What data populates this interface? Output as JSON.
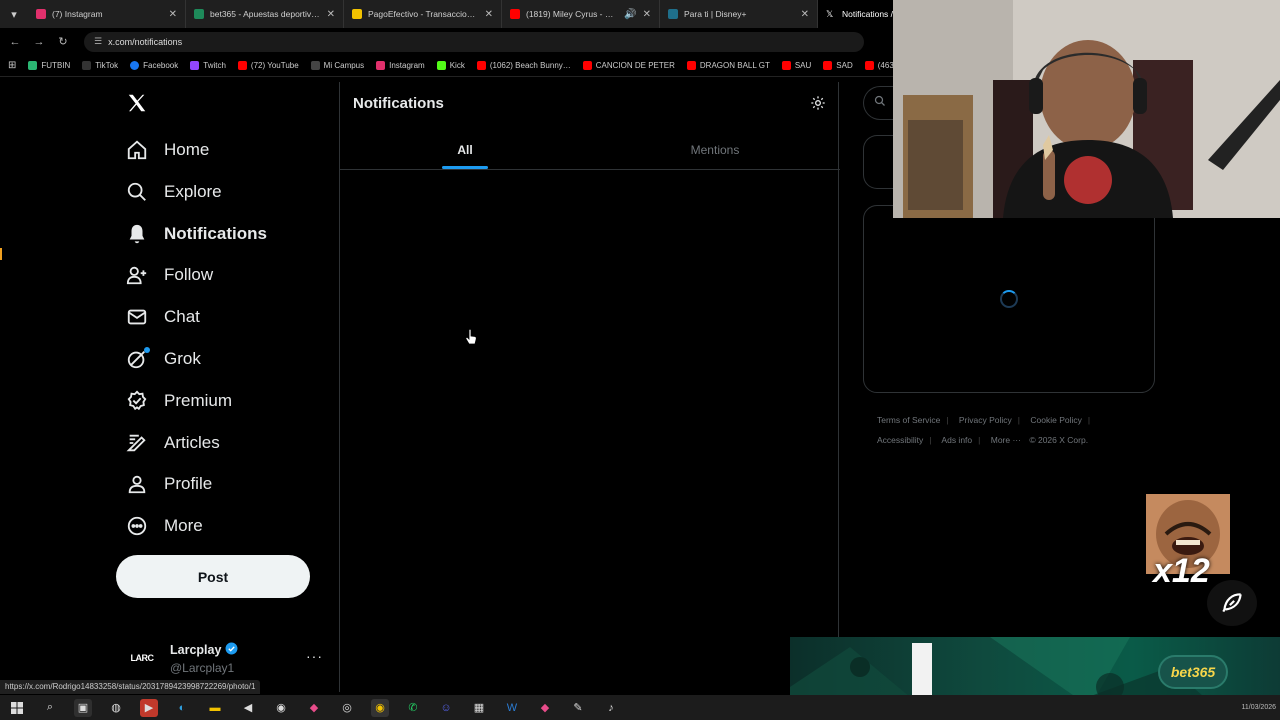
{
  "browser": {
    "tabs": [
      {
        "title": "(7) Instagram",
        "color": "#e1306c"
      },
      {
        "title": "bet365 - Apuestas deportivas en…",
        "color": "#1e8a5a"
      },
      {
        "title": "PagoEfectivo - Transacciones Se…",
        "color": "#f2c200"
      },
      {
        "title": "(1819) Miley Cyrus - Party In…",
        "color": "#ff0000"
      },
      {
        "title": "Para ti | Disney+",
        "color": "#1f6f8b"
      },
      {
        "title": "Notifications /",
        "color": "#ffffff"
      }
    ],
    "url": "x.com/notifications",
    "bookmarks": [
      {
        "label": "FUTBIN",
        "color": "#2bb673"
      },
      {
        "label": "TikTok",
        "color": "#ffffff"
      },
      {
        "label": "Facebook",
        "color": "#1877f2"
      },
      {
        "label": "Twitch",
        "color": "#9146ff"
      },
      {
        "label": "(72) YouTube",
        "color": "#ff0000"
      },
      {
        "label": "Mi Campus",
        "color": "#444444"
      },
      {
        "label": "Instagram",
        "color": "#e1306c"
      },
      {
        "label": "Kick",
        "color": "#53fc18"
      },
      {
        "label": "(1062) Beach Bunny…",
        "color": "#ff0000"
      },
      {
        "label": "CANCION DE PETER",
        "color": "#ff0000"
      },
      {
        "label": "DRAGON BALL GT",
        "color": "#ff0000"
      },
      {
        "label": "SAU",
        "color": "#ff0000"
      },
      {
        "label": "SAD",
        "color": "#ff0000"
      },
      {
        "label": "(463) J",
        "color": "#ff0000"
      }
    ],
    "status_url": "https://x.com/Rodrigo14833258/status/2031789423998722269/photo/1"
  },
  "nav": {
    "items": [
      {
        "label": "Home",
        "icon": "home-icon"
      },
      {
        "label": "Explore",
        "icon": "search-icon"
      },
      {
        "label": "Notifications",
        "icon": "bell-icon"
      },
      {
        "label": "Follow",
        "icon": "follow-icon"
      },
      {
        "label": "Chat",
        "icon": "mail-icon"
      },
      {
        "label": "Grok",
        "icon": "grok-icon"
      },
      {
        "label": "Premium",
        "icon": "premium-icon"
      },
      {
        "label": "Articles",
        "icon": "articles-icon"
      },
      {
        "label": "Profile",
        "icon": "profile-icon"
      },
      {
        "label": "More",
        "icon": "more-icon"
      }
    ],
    "post_label": "Post"
  },
  "account": {
    "avatar_text": "LARC",
    "name": "Larcplay",
    "handle": "@Larcplay1"
  },
  "main": {
    "title": "Notifications",
    "tabs": [
      {
        "label": "All",
        "active": true
      },
      {
        "label": "Mentions",
        "active": false
      }
    ]
  },
  "footer": {
    "links": [
      "Terms of Service",
      "Privacy Policy",
      "Cookie Policy",
      "Accessibility",
      "Ads info",
      "More ···"
    ],
    "copyright": "© 2026 X Corp."
  },
  "overlay": {
    "meme_count": "x12",
    "banner_brand": "bet365"
  },
  "taskbar": {
    "date": "11/03/2026"
  },
  "colors": {
    "accent": "#1d9bf0",
    "border": "#2f3336",
    "muted": "#71767b"
  }
}
